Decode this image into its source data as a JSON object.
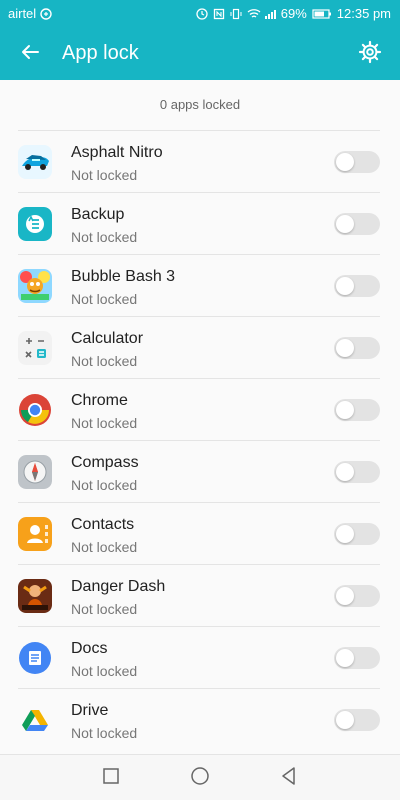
{
  "status_bar": {
    "carrier": "airtel",
    "battery": "69%",
    "time": "12:35 pm"
  },
  "header": {
    "title": "App lock",
    "back_icon": "back-arrow-icon",
    "settings_icon": "gear-icon",
    "accent_color": "#17b5c4"
  },
  "summary": {
    "locked_count_text": "0 apps locked"
  },
  "apps": [
    {
      "name": "Asphalt Nitro",
      "status": "Not locked",
      "locked": false,
      "icon": "asphalt-nitro-icon"
    },
    {
      "name": "Backup",
      "status": "Not locked",
      "locked": false,
      "icon": "backup-icon"
    },
    {
      "name": "Bubble Bash 3",
      "status": "Not locked",
      "locked": false,
      "icon": "bubble-bash-icon"
    },
    {
      "name": "Calculator",
      "status": "Not locked",
      "locked": false,
      "icon": "calculator-icon"
    },
    {
      "name": "Chrome",
      "status": "Not locked",
      "locked": false,
      "icon": "chrome-icon"
    },
    {
      "name": "Compass",
      "status": "Not locked",
      "locked": false,
      "icon": "compass-icon"
    },
    {
      "name": "Contacts",
      "status": "Not locked",
      "locked": false,
      "icon": "contacts-icon"
    },
    {
      "name": "Danger Dash",
      "status": "Not locked",
      "locked": false,
      "icon": "danger-dash-icon"
    },
    {
      "name": "Docs",
      "status": "Not locked",
      "locked": false,
      "icon": "docs-icon"
    },
    {
      "name": "Drive",
      "status": "Not locked",
      "locked": false,
      "icon": "drive-icon"
    }
  ],
  "nav_bar": {
    "icons": [
      "recent-apps-icon",
      "home-icon",
      "back-icon"
    ]
  }
}
